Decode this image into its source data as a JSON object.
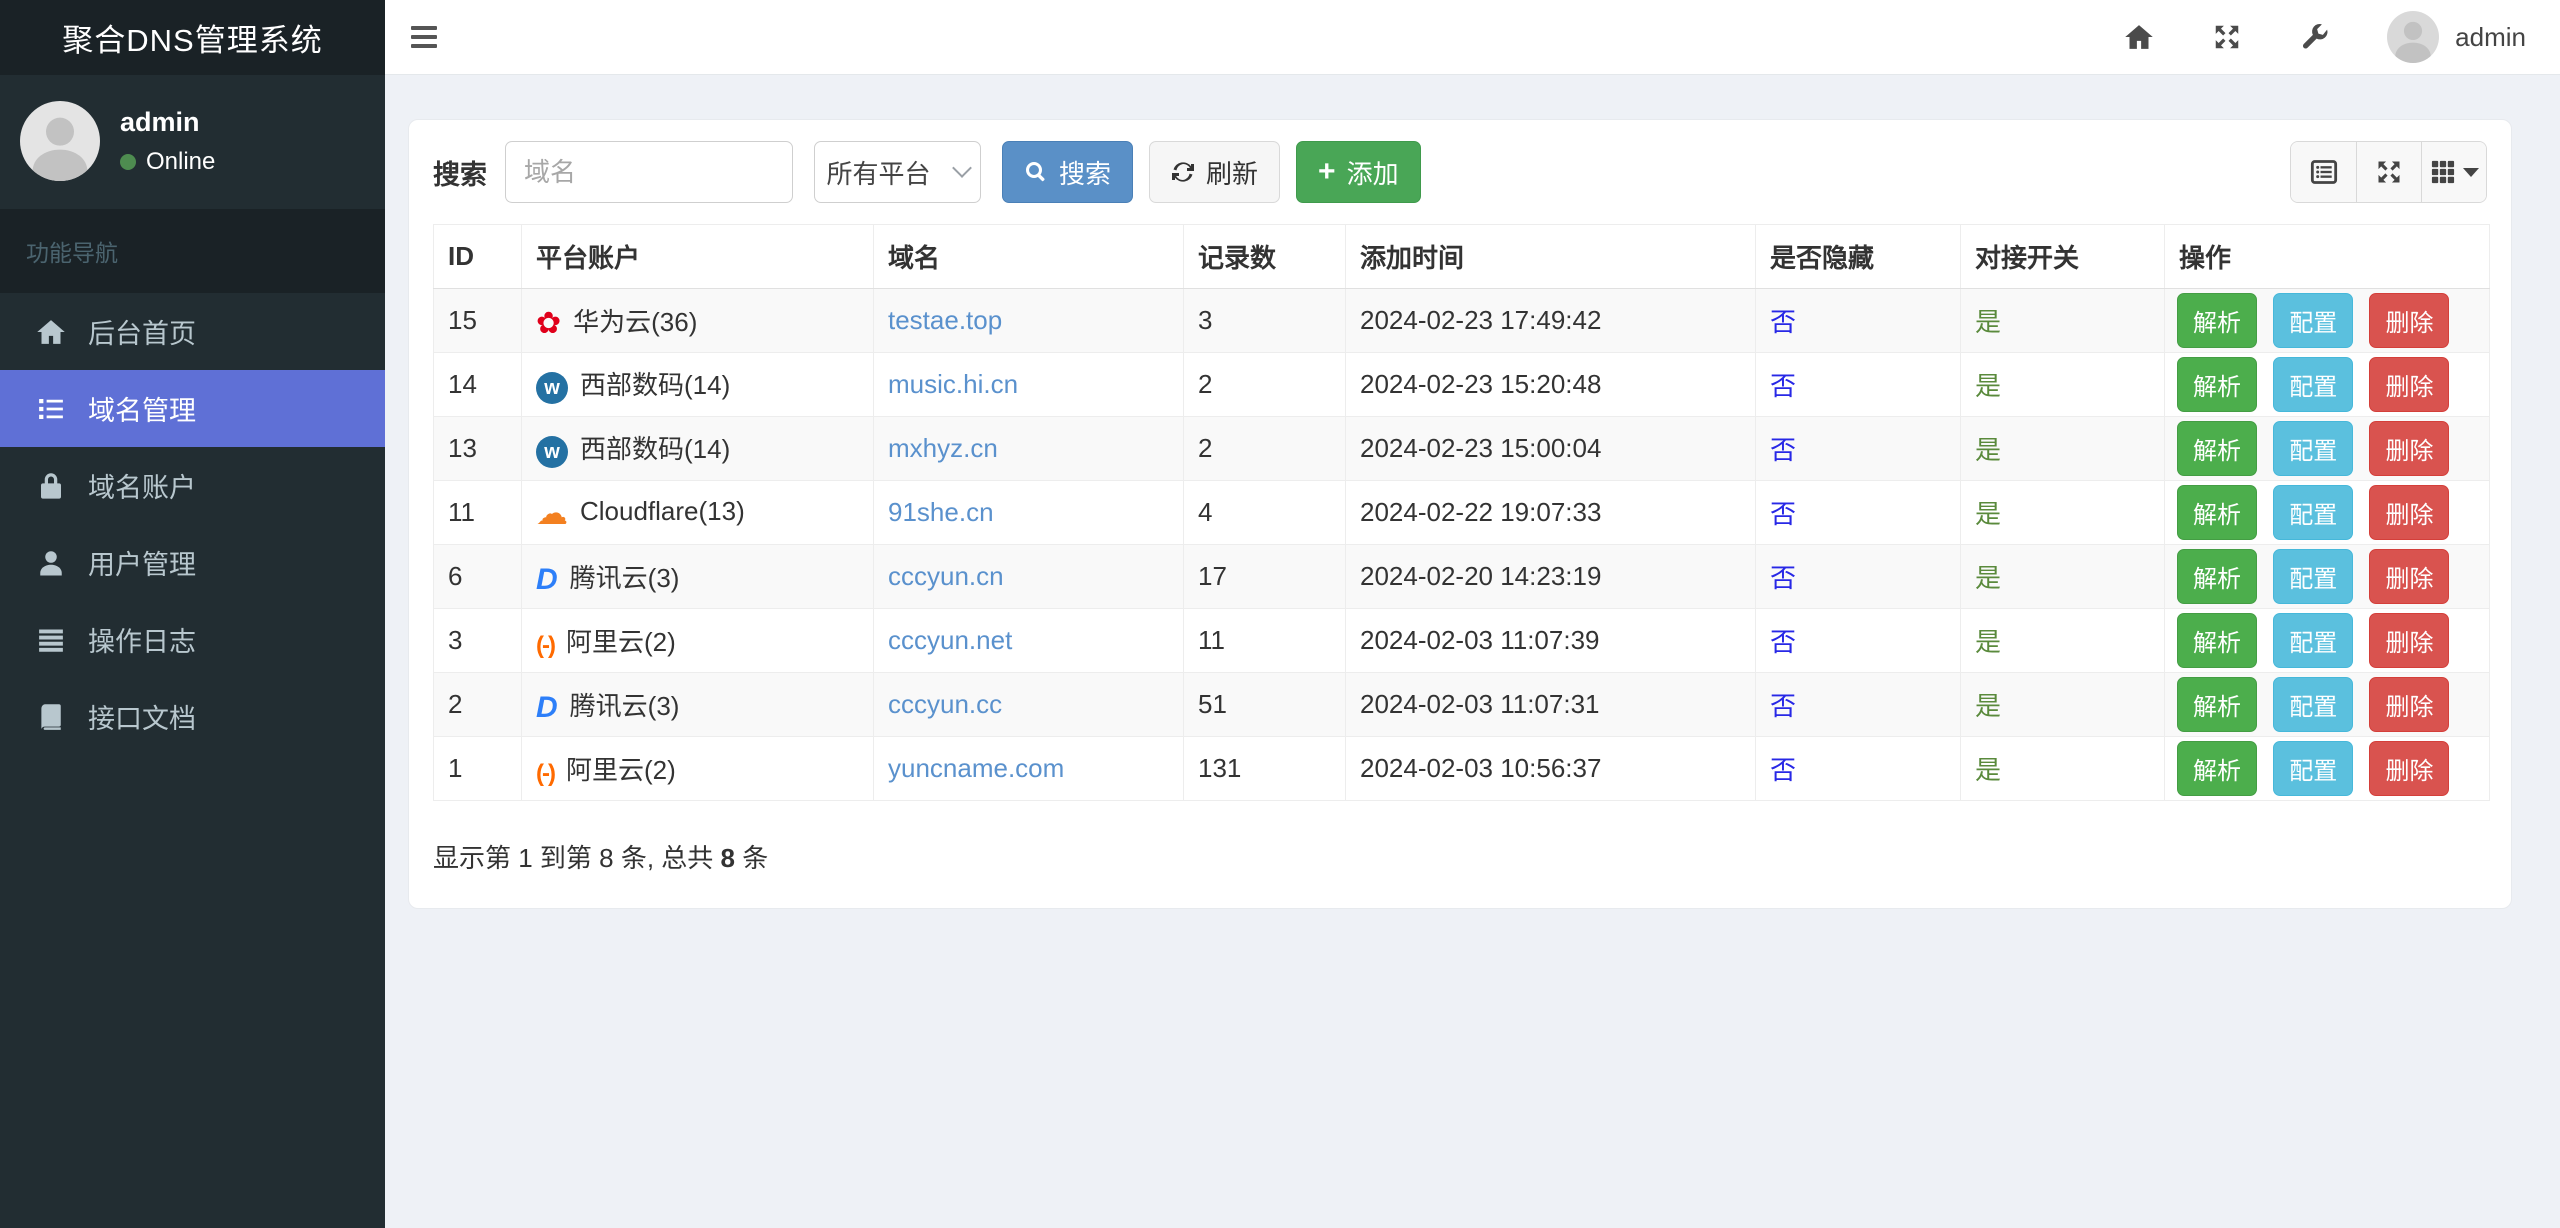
{
  "app": {
    "title": "聚合DNS管理系统"
  },
  "colors": {
    "sidebar_bg": "#222d32",
    "sidebar_dark": "#1a2226",
    "active_nav": "#5f70d6",
    "primary": "#5a90c7",
    "success": "#49a656",
    "info": "#5bc0de",
    "danger": "#d9534f",
    "link": "#5a91cd",
    "hidden_no": "#2828e6",
    "switch_yes": "#5a8a3c",
    "online_dot": "#4e8c50"
  },
  "topbar": {
    "username": "admin",
    "icons": [
      "menu-icon",
      "home-icon",
      "fullscreen-icon",
      "wrench-icon"
    ]
  },
  "sidebar": {
    "user": {
      "name": "admin",
      "status": "Online"
    },
    "section_label": "功能导航",
    "items": [
      {
        "label": "后台首页",
        "icon": "home-icon",
        "active": false
      },
      {
        "label": "域名管理",
        "icon": "list-icon",
        "active": true
      },
      {
        "label": "域名账户",
        "icon": "lock-icon",
        "active": false
      },
      {
        "label": "用户管理",
        "icon": "user-icon",
        "active": false
      },
      {
        "label": "操作日志",
        "icon": "log-icon",
        "active": false
      },
      {
        "label": "接口文档",
        "icon": "book-icon",
        "active": false
      }
    ]
  },
  "toolbar": {
    "search_label": "搜索",
    "search_placeholder": "域名",
    "platform_select_value": "所有平台",
    "search_button": "搜索",
    "refresh_button": "刷新",
    "add_button": "添加",
    "view_icons": [
      "detail-view-icon",
      "fullscreen-view-icon",
      "columns-view-icon"
    ]
  },
  "table": {
    "columns": [
      "ID",
      "平台账户",
      "域名",
      "记录数",
      "添加时间",
      "是否隐藏",
      "对接开关",
      "操作"
    ],
    "action_labels": {
      "resolve": "解析",
      "config": "配置",
      "delete": "删除"
    },
    "rows": [
      {
        "id": "15",
        "platform": "华为云(36)",
        "platform_icon": "huawei",
        "domain": "testae.top",
        "records": "3",
        "added": "2024-02-23 17:49:42",
        "hidden": "否",
        "enabled": "是"
      },
      {
        "id": "14",
        "platform": "西部数码(14)",
        "platform_icon": "west",
        "domain": "music.hi.cn",
        "records": "2",
        "added": "2024-02-23 15:20:48",
        "hidden": "否",
        "enabled": "是"
      },
      {
        "id": "13",
        "platform": "西部数码(14)",
        "platform_icon": "west",
        "domain": "mxhyz.cn",
        "records": "2",
        "added": "2024-02-23 15:00:04",
        "hidden": "否",
        "enabled": "是"
      },
      {
        "id": "11",
        "platform": "Cloudflare(13)",
        "platform_icon": "cloudflare",
        "domain": "91she.cn",
        "records": "4",
        "added": "2024-02-22 19:07:33",
        "hidden": "否",
        "enabled": "是"
      },
      {
        "id": "6",
        "platform": "腾讯云(3)",
        "platform_icon": "tencent",
        "domain": "cccyun.cn",
        "records": "17",
        "added": "2024-02-20 14:23:19",
        "hidden": "否",
        "enabled": "是"
      },
      {
        "id": "3",
        "platform": "阿里云(2)",
        "platform_icon": "aliyun",
        "domain": "cccyun.net",
        "records": "11",
        "added": "2024-02-03 11:07:39",
        "hidden": "否",
        "enabled": "是"
      },
      {
        "id": "2",
        "platform": "腾讯云(3)",
        "platform_icon": "tencent",
        "domain": "cccyun.cc",
        "records": "51",
        "added": "2024-02-03 11:07:31",
        "hidden": "否",
        "enabled": "是"
      },
      {
        "id": "1",
        "platform": "阿里云(2)",
        "platform_icon": "aliyun",
        "domain": "yuncname.com",
        "records": "131",
        "added": "2024-02-03 10:56:37",
        "hidden": "否",
        "enabled": "是"
      }
    ]
  },
  "pagination": {
    "summary_prefix": "显示第 1 到第 8 条, 总共 ",
    "total": "8",
    "summary_suffix": " 条"
  }
}
